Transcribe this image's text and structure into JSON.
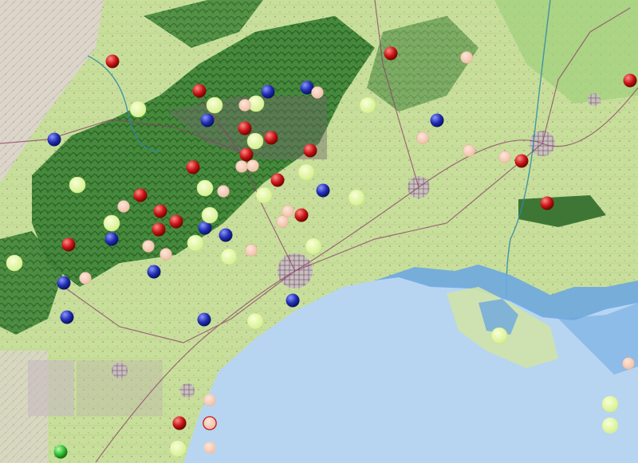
{
  "map": {
    "type": "topographic-satellite-overlay",
    "colors": {
      "sea": "#b7d5f1",
      "lagoon": "#6ea8e0",
      "lowland": "#cfe3a8",
      "upland": "#5f9f4c",
      "forest": "#2f6b2a",
      "urban": "#6b3b5a",
      "inland_west": "#d9d5c6"
    },
    "marker_colors": {
      "red": "#c81414",
      "blue": "#1f2db0",
      "green": "#2fbf2f",
      "light-green": "#dff59a",
      "peach": "#f2c7b1",
      "outlined": "#ffd7cf"
    },
    "markers": [
      {
        "category": "red"
      },
      {
        "category": "red"
      },
      {
        "category": "red"
      },
      {
        "category": "red"
      },
      {
        "category": "red"
      },
      {
        "category": "red"
      },
      {
        "category": "red"
      },
      {
        "category": "red"
      },
      {
        "category": "red"
      },
      {
        "category": "red"
      },
      {
        "category": "red"
      },
      {
        "category": "red"
      },
      {
        "category": "red"
      },
      {
        "category": "red"
      },
      {
        "category": "red"
      },
      {
        "category": "red"
      },
      {
        "category": "red"
      },
      {
        "category": "red"
      },
      {
        "category": "red"
      },
      {
        "category": "blue"
      },
      {
        "category": "blue"
      },
      {
        "category": "blue"
      },
      {
        "category": "blue"
      },
      {
        "category": "blue"
      },
      {
        "category": "blue"
      },
      {
        "category": "blue"
      },
      {
        "category": "blue"
      },
      {
        "category": "blue"
      },
      {
        "category": "blue"
      },
      {
        "category": "blue"
      },
      {
        "category": "blue"
      },
      {
        "category": "blue"
      },
      {
        "category": "blue"
      },
      {
        "category": "green"
      },
      {
        "category": "light-green"
      },
      {
        "category": "light-green"
      },
      {
        "category": "light-green"
      },
      {
        "category": "light-green"
      },
      {
        "category": "light-green"
      },
      {
        "category": "light-green"
      },
      {
        "category": "light-green"
      },
      {
        "category": "light-green"
      },
      {
        "category": "light-green"
      },
      {
        "category": "light-green"
      },
      {
        "category": "light-green"
      },
      {
        "category": "light-green"
      },
      {
        "category": "light-green"
      },
      {
        "category": "light-green"
      },
      {
        "category": "light-green"
      },
      {
        "category": "light-green"
      },
      {
        "category": "light-green"
      },
      {
        "category": "light-green"
      },
      {
        "category": "light-green"
      },
      {
        "category": "peach"
      },
      {
        "category": "peach"
      },
      {
        "category": "peach"
      },
      {
        "category": "peach"
      },
      {
        "category": "peach"
      },
      {
        "category": "peach"
      },
      {
        "category": "peach"
      },
      {
        "category": "peach"
      },
      {
        "category": "peach"
      },
      {
        "category": "peach"
      },
      {
        "category": "peach"
      },
      {
        "category": "peach"
      },
      {
        "category": "peach"
      },
      {
        "category": "peach"
      },
      {
        "category": "peach"
      },
      {
        "category": "peach"
      },
      {
        "category": "peach"
      },
      {
        "category": "peach"
      },
      {
        "category": "peach"
      },
      {
        "category": "peach"
      },
      {
        "category": "outlined"
      }
    ],
    "legend": [
      {
        "category": "red"
      },
      {
        "category": "light-green"
      },
      {
        "category": "peach"
      },
      {
        "category": "peach"
      },
      {
        "category": "peach"
      },
      {
        "category": "light-green"
      },
      {
        "category": "light-green"
      }
    ]
  }
}
